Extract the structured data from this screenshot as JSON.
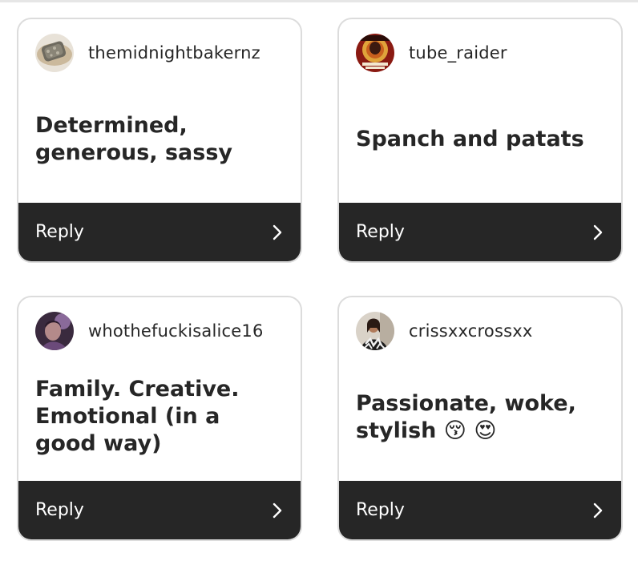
{
  "cards": [
    {
      "username": "themidnightbakernz",
      "text": "Determined, generous, sassy",
      "avatar_icon": "bread-photo-avatar",
      "reply_label": "Reply"
    },
    {
      "username": "tube_raider",
      "text": "Spanch and patats",
      "avatar_icon": "poster-photo-avatar",
      "reply_label": "Reply"
    },
    {
      "username": "whothefuckisalice16",
      "text": "Family. Creative. Emotional (in a good way)",
      "avatar_icon": "portrait-photo-avatar",
      "reply_label": "Reply"
    },
    {
      "username": "crissxxcrossxx",
      "text": "Passionate, woke, stylish 😚 😍",
      "avatar_icon": "person-photo-avatar",
      "reply_label": "Reply"
    }
  ],
  "colors": {
    "reply_bar": "#262626",
    "card_border": "#dcdcdc",
    "text": "#262626"
  }
}
